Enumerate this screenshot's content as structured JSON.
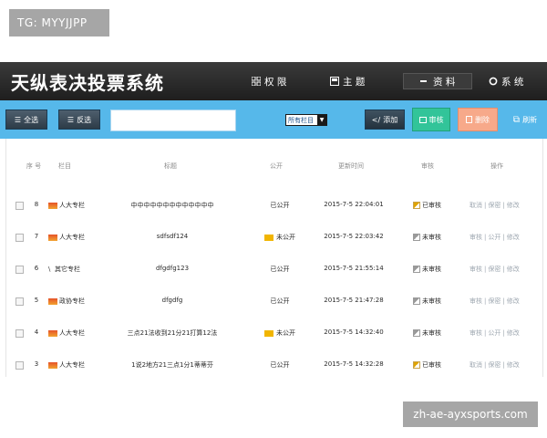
{
  "overlay": {
    "tg_label": "TG: MYYJJPP",
    "watermark": "zh-ae-ayxsports.com"
  },
  "app": {
    "title": "天纵表决投票系统"
  },
  "nav": [
    {
      "label": "权 限",
      "icon": "grid-icon"
    },
    {
      "label": "主 题",
      "icon": "board-icon"
    },
    {
      "label": "资 料",
      "icon": "dash-icon"
    },
    {
      "label": "系 统",
      "icon": "circle-icon"
    }
  ],
  "toolbar": {
    "select_all": "全选",
    "invert": "反选",
    "search_value": "",
    "category_select": "所有栏目",
    "add": "添加",
    "review": "审核",
    "delete": "删除",
    "refresh": "刷新"
  },
  "table": {
    "columns": [
      "序 号",
      "栏目",
      "标题",
      "公开",
      "更新时间",
      "审核",
      "操作"
    ],
    "rows": [
      {
        "id": "8",
        "column": "人大专栏",
        "title": "中中中中中中中中中中中中中",
        "public": "已公开",
        "public_flag": false,
        "updated": "2015-7-5 22:04:01",
        "review": "已审核",
        "review_ok": true,
        "ops": [
          "取消",
          "保密",
          "修改"
        ]
      },
      {
        "id": "7",
        "column": "人大专栏",
        "title": "sdfsdf124",
        "public": "未公开",
        "public_flag": true,
        "updated": "2015-7-5 22:03:42",
        "review": "未审核",
        "review_ok": false,
        "ops": [
          "审核",
          "公开",
          "修改"
        ]
      },
      {
        "id": "6",
        "column": "其它专栏",
        "title": "dfgdfg123",
        "public": "已公开",
        "public_flag": false,
        "updated": "2015-7-5 21:55:14",
        "review": "未审核",
        "review_ok": false,
        "ops": [
          "审核",
          "保密",
          "修改"
        ]
      },
      {
        "id": "5",
        "column": "政协专栏",
        "title": "dfgdfg",
        "public": "已公开",
        "public_flag": false,
        "updated": "2015-7-5 21:47:28",
        "review": "未审核",
        "review_ok": false,
        "ops": [
          "审核",
          "保密",
          "修改"
        ]
      },
      {
        "id": "4",
        "column": "人大专栏",
        "title": "三点21法收到21分21打算12法",
        "public": "未公开",
        "public_flag": true,
        "updated": "2015-7-5 14:32:40",
        "review": "未审核",
        "review_ok": false,
        "ops": [
          "审核",
          "公开",
          "修改"
        ]
      },
      {
        "id": "3",
        "column": "人大专栏",
        "title": "1说2地方21三点1分1蒂蒂芬",
        "public": "已公开",
        "public_flag": false,
        "updated": "2015-7-5 14:32:28",
        "review": "已审核",
        "review_ok": true,
        "ops": [
          "取消",
          "保密",
          "修改"
        ]
      }
    ]
  }
}
